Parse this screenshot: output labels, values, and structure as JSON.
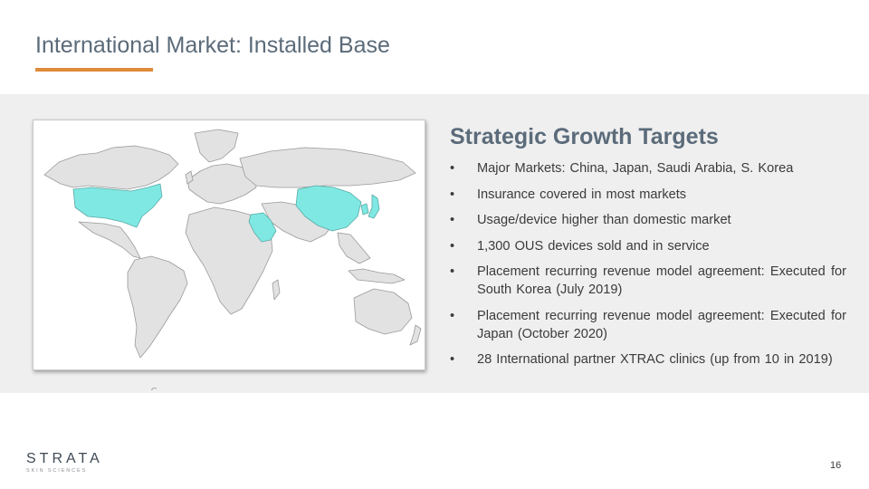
{
  "slide": {
    "title": "International Market: Installed Base",
    "page_number": "16"
  },
  "map": {
    "highlighted_regions": [
      "United States",
      "China",
      "Japan",
      "Saudi Arabia",
      "South Korea"
    ],
    "land_color": "#e2e2e2",
    "border_color": "#9a9a9a",
    "highlight_color": "#7fe8e2"
  },
  "targets": {
    "heading": "Strategic Growth Targets",
    "bullet_glyph": "•",
    "items": [
      "Major Markets: China, Japan, Saudi Arabia, S. Korea",
      "Insurance covered in most markets",
      "Usage/device higher than domestic market",
      "1,300 OUS devices sold and in service",
      "Placement recurring revenue model agreement: Executed for South Korea (July 2019)",
      "Placement recurring revenue model agreement: Executed for Japan (October 2020)",
      "28 International partner XTRAC clinics (up from 10 in 2019)"
    ]
  },
  "logo": {
    "name": "STRATA",
    "tagline": "SKIN SCIENCES"
  },
  "colors": {
    "title": "#5b6b7a",
    "accent_rule": "#e08b3a",
    "band": "#efefef",
    "text": "#3b3b3b"
  }
}
